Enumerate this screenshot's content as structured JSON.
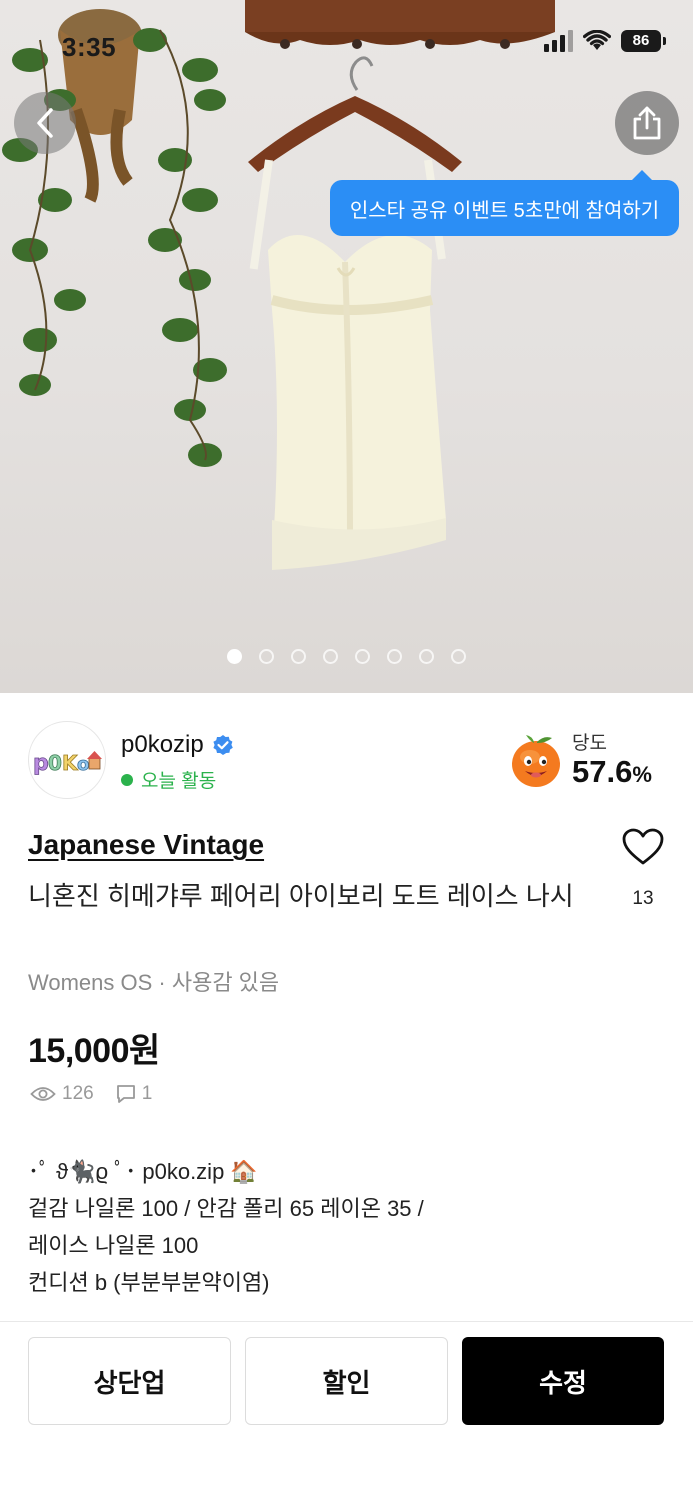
{
  "status_bar": {
    "time": "3:35",
    "battery": "86"
  },
  "hero": {
    "page_count": 8,
    "active_index": 0
  },
  "tooltip": {
    "text": "인스타 공유 이벤트 5초만에 참여하기"
  },
  "seller": {
    "name": "p0kozip",
    "activity": "오늘 활동",
    "avatar_text": "p0ko"
  },
  "sweetness": {
    "label": "당도",
    "value": "57.6",
    "unit": "%"
  },
  "product": {
    "brand": "Japanese Vintage",
    "title": "니혼진 히메갸루 페어리 아이보리 도트 레이스 나시",
    "category": "Womens OS · 사용감 있음",
    "price": "15,000원",
    "likes": "13",
    "views": "126",
    "comments": "1"
  },
  "description": [
    "･ﾟ ϑ🐈‍⬛ϱ ﾟ･ p0ko.zip 🏠",
    "겉감 나일론 100 / 안감 폴리 65 레이온 35 /",
    "레이스 나일론 100",
    "컨디션 b (부분부분약이염)"
  ],
  "actions": {
    "bump": "상단업",
    "discount": "할인",
    "edit": "수정"
  },
  "colors": {
    "accent_blue": "#2b8ef5",
    "active_green": "#2bb24c",
    "primary_black": "#000000"
  }
}
